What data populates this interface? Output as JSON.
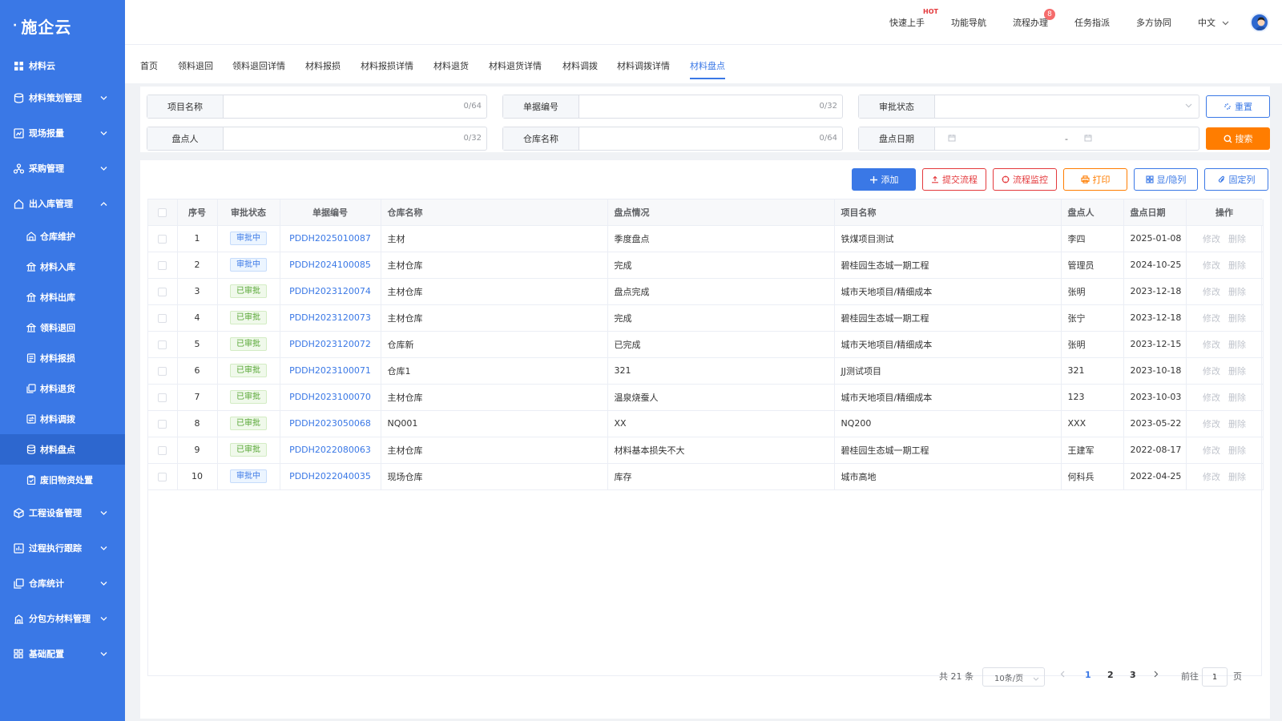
{
  "logo": {
    "text": "施企云"
  },
  "sidebar": {
    "top": "材料云",
    "groups": [
      {
        "label": "材料策划管理"
      },
      {
        "label": "现场报量"
      },
      {
        "label": "采购管理"
      },
      {
        "label": "出入库管理"
      }
    ],
    "subitems": [
      {
        "label": "仓库维护"
      },
      {
        "label": "材料入库"
      },
      {
        "label": "材料出库"
      },
      {
        "label": "领料退回"
      },
      {
        "label": "材料报损"
      },
      {
        "label": "材料退货"
      },
      {
        "label": "材料调拨"
      },
      {
        "label": "材料盘点"
      },
      {
        "label": "废旧物资处置"
      }
    ],
    "groups2": [
      {
        "label": "工程设备管理"
      },
      {
        "label": "过程执行跟踪"
      },
      {
        "label": "仓库统计"
      },
      {
        "label": "分包方材料管理"
      },
      {
        "label": "基础配置"
      }
    ]
  },
  "header": {
    "hot": "HOT",
    "quick": "快速上手",
    "nav": "功能导航",
    "process": "流程办理",
    "process_badge": "8",
    "task": "任务指派",
    "collab": "多方协同",
    "lang": "中文"
  },
  "tabs": [
    "首页",
    "领料退回",
    "领料退回详情",
    "材料报损",
    "材料报损详情",
    "材料退货",
    "材料退货详情",
    "材料调拨",
    "材料调拨详情",
    "材料盘点"
  ],
  "filter": {
    "project_label": "项目名称",
    "project_count": "0/64",
    "doc_label": "单据编号",
    "doc_count": "0/32",
    "status_label": "审批状态",
    "person_label": "盘点人",
    "person_count": "0/32",
    "warehouse_label": "仓库名称",
    "warehouse_count": "0/64",
    "date_label": "盘点日期",
    "date_sep": "-",
    "reset": "重置",
    "search": "搜索"
  },
  "toolbar": {
    "add": "添加",
    "submit": "提交流程",
    "monitor": "流程监控",
    "print": "打印",
    "toggle": "显/隐列",
    "fixed": "固定列"
  },
  "table": {
    "headers": [
      "序号",
      "审批状态",
      "单据编号",
      "仓库名称",
      "盘点情况",
      "项目名称",
      "盘点人",
      "盘点日期",
      "操作"
    ],
    "edit": "修改",
    "delete": "删除",
    "rows": [
      {
        "no": "1",
        "status": "审批中",
        "code": "PDDH2025010087",
        "warehouse": "主材",
        "situation": "季度盘点",
        "project": "铁煤项目测试",
        "person": "李四",
        "date": "2025-01-08"
      },
      {
        "no": "2",
        "status": "审批中",
        "code": "PDDH2024100085",
        "warehouse": "主材仓库",
        "situation": "完成",
        "project": "碧桂园生态城一期工程",
        "person": "管理员",
        "date": "2024-10-25"
      },
      {
        "no": "3",
        "status": "已审批",
        "code": "PDDH2023120074",
        "warehouse": "主材仓库",
        "situation": "盘点完成",
        "project": "城市天地项目/精细成本",
        "person": "张明",
        "date": "2023-12-18"
      },
      {
        "no": "4",
        "status": "已审批",
        "code": "PDDH2023120073",
        "warehouse": "主材仓库",
        "situation": "完成",
        "project": "碧桂园生态城一期工程",
        "person": "张宁",
        "date": "2023-12-18"
      },
      {
        "no": "5",
        "status": "已审批",
        "code": "PDDH2023120072",
        "warehouse": "仓库新",
        "situation": "已完成",
        "project": "城市天地项目/精细成本",
        "person": "张明",
        "date": "2023-12-15"
      },
      {
        "no": "6",
        "status": "已审批",
        "code": "PDDH2023100071",
        "warehouse": "仓库1",
        "situation": "321",
        "project": "JJ测试项目",
        "person": "321",
        "date": "2023-10-18"
      },
      {
        "no": "7",
        "status": "已审批",
        "code": "PDDH2023100070",
        "warehouse": "主材仓库",
        "situation": "温泉烧蚕人",
        "project": "城市天地项目/精细成本",
        "person": "123",
        "date": "2023-10-03"
      },
      {
        "no": "8",
        "status": "已审批",
        "code": "PDDH2023050068",
        "warehouse": "NQ001",
        "situation": "XX",
        "project": "NQ200",
        "person": "XXX",
        "date": "2023-05-22"
      },
      {
        "no": "9",
        "status": "已审批",
        "code": "PDDH2022080063",
        "warehouse": "主材仓库",
        "situation": "材料基本损失不大",
        "project": "碧桂园生态城一期工程",
        "person": "王建军",
        "date": "2022-08-17"
      },
      {
        "no": "10",
        "status": "审批中",
        "code": "PDDH2022040035",
        "warehouse": "现场仓库",
        "situation": "库存",
        "project": "城市高地",
        "person": "何科兵",
        "date": "2022-04-25"
      }
    ]
  },
  "pagination": {
    "total": "共 21 条",
    "page_size": "10条/页",
    "pages": [
      "1",
      "2",
      "3"
    ],
    "goto": "前往",
    "current": "1",
    "page_unit": "页"
  },
  "colors": {
    "primary": "#3a78e6",
    "orange": "#ff7d00",
    "danger": "#e4393c"
  }
}
